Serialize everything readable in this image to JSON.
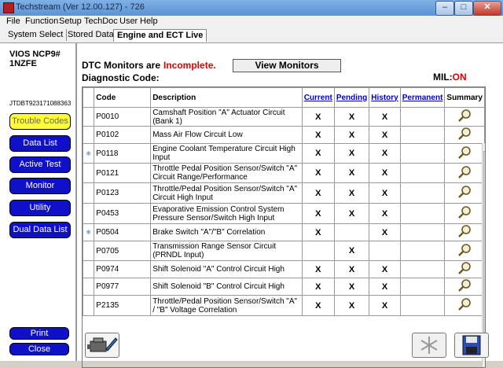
{
  "window": {
    "title": "Techstream (Ver 12.00.127) - 726",
    "minimize": "–",
    "maximize": "□",
    "close": "✕"
  },
  "menu": [
    "File",
    "Function",
    "Setup",
    "TechDoc",
    "User",
    "Help"
  ],
  "tabs": [
    "System Select",
    "Stored Data",
    "Engine and ECT Live"
  ],
  "vehicle": {
    "model": "VIOS NCP9#",
    "engine": "1NZFE",
    "vin": "JTDBT923171088363"
  },
  "left_buttons": [
    "Trouble Codes",
    "Data List",
    "Active Test",
    "Monitor",
    "Utility",
    "Dual Data List"
  ],
  "bottom_buttons": {
    "print": "Print",
    "close": "Close"
  },
  "dtc": {
    "monitors_label": "DTC Monitors are",
    "monitors_status": "Incomplete.",
    "view_monitors": "View Monitors",
    "diagnostic_label": "Diagnostic Code:",
    "mil_label": "MIL:",
    "mil_value": "ON",
    "columns": [
      "Code",
      "Description",
      "Current",
      "Pending",
      "History",
      "Permanent",
      "Summary"
    ],
    "rows": [
      {
        "code": "P0010",
        "description": "Camshaft Position \"A\" Actuator Circuit (Bank 1)",
        "current": "X",
        "pending": "X",
        "history": "X",
        "permanent": "",
        "marker": ""
      },
      {
        "code": "P0102",
        "description": "Mass Air Flow Circuit Low",
        "current": "X",
        "pending": "X",
        "history": "X",
        "permanent": "",
        "marker": ""
      },
      {
        "code": "P0118",
        "description": "Engine Coolant Temperature Circuit High Input",
        "current": "X",
        "pending": "X",
        "history": "X",
        "permanent": "",
        "marker": "❄"
      },
      {
        "code": "P0121",
        "description": "Throttle Pedal Position Sensor/Switch \"A\" Circuit Range/Performance",
        "current": "X",
        "pending": "X",
        "history": "X",
        "permanent": "",
        "marker": ""
      },
      {
        "code": "P0123",
        "description": "Throttle/Pedal Position Sensor/Switch \"A\" Circuit High Input",
        "current": "X",
        "pending": "X",
        "history": "X",
        "permanent": "",
        "marker": ""
      },
      {
        "code": "P0453",
        "description": "Evaporative Emission Control System Pressure Sensor/Switch High Input",
        "current": "X",
        "pending": "X",
        "history": "X",
        "permanent": "",
        "marker": ""
      },
      {
        "code": "P0504",
        "description": "Brake Switch \"A\"/\"B\" Correlation",
        "current": "X",
        "pending": "",
        "history": "X",
        "permanent": "",
        "marker": "❄"
      },
      {
        "code": "P0705",
        "description": "Transmission Range Sensor Circuit (PRNDL Input)",
        "current": "",
        "pending": "X",
        "history": "",
        "permanent": "",
        "marker": ""
      },
      {
        "code": "P0974",
        "description": "Shift Solenoid \"A\" Control Circuit High",
        "current": "X",
        "pending": "X",
        "history": "X",
        "permanent": "",
        "marker": ""
      },
      {
        "code": "P0977",
        "description": "Shift Solenoid \"B\" Control Circuit High",
        "current": "X",
        "pending": "X",
        "history": "X",
        "permanent": "",
        "marker": ""
      },
      {
        "code": "P2135",
        "description": "Throttle/Pedal Position Sensor/Switch \"A\" / \"B\" Voltage Correlation",
        "current": "X",
        "pending": "X",
        "history": "X",
        "permanent": "",
        "marker": ""
      }
    ]
  },
  "colors": {
    "incomplete": "#e00000",
    "mil_on": "#e00000",
    "nav_button": "#1010c8",
    "nav_selected": "#ffff33",
    "column_link": "#0000cc"
  }
}
